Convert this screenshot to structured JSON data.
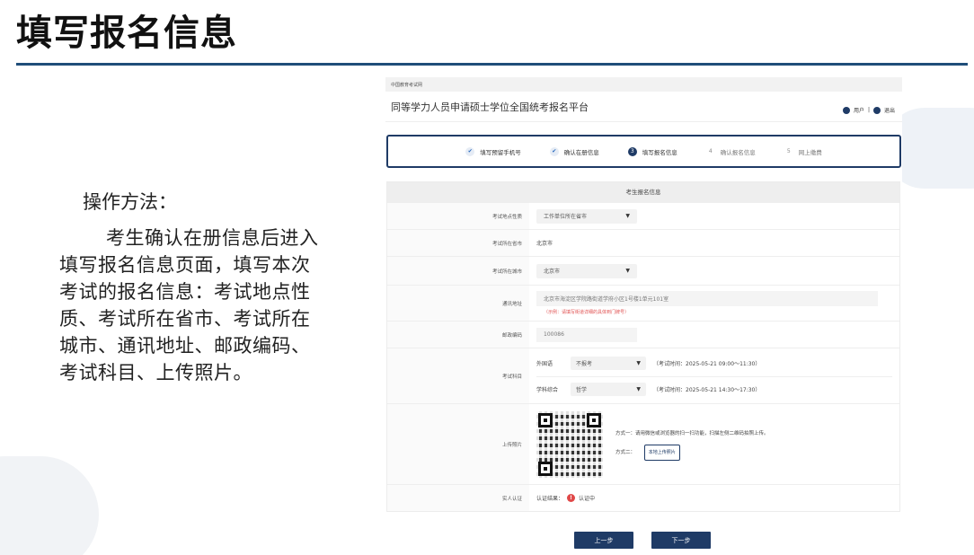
{
  "slide": {
    "title": "填写报名信息",
    "instructions_heading": "操作方法：",
    "instructions_body": "考生确认在册信息后进入填写报名信息页面，填写本次考试的报名信息：考试地点性质、考试所在省市、考试所在城市、通讯地址、邮政编码、考试科目、上传照片。"
  },
  "screenshot": {
    "topbar_text": "中国教育考试网",
    "platform_title": "同等学力人员申请硕士学位全国统考报名平台",
    "user": {
      "name_label": "用户",
      "logout_label": "退出",
      "separator": "|"
    },
    "steps": [
      {
        "num": "✔",
        "label": "填写预留手机号",
        "state": "done"
      },
      {
        "num": "✔",
        "label": "确认在册信息",
        "state": "done"
      },
      {
        "num": "3",
        "label": "填写报名信息",
        "state": "current"
      },
      {
        "num": "4",
        "label": "确认报名信息",
        "state": "todo"
      },
      {
        "num": "5",
        "label": "网上缴费",
        "state": "todo"
      }
    ],
    "form": {
      "header": "考生报名信息",
      "site_type": {
        "label": "考试地点性质",
        "value": "工作单位所在省市"
      },
      "province": {
        "label": "考试所在省市",
        "value": "北京市"
      },
      "city": {
        "label": "考试所在城市",
        "value": "北京市"
      },
      "address": {
        "label": "通讯地址",
        "value": "北京市海淀区学院路街道学府小区1号楼1单元101室",
        "note": "（示例：请填写街道详细的具体到门牌号）"
      },
      "postal": {
        "label": "邮政编码",
        "value": "100086"
      },
      "subjects": {
        "label": "考试科目",
        "items": [
          {
            "name": "外国语",
            "value": "不报考",
            "time": "（考试时间：2025-05-21 09:00～11:30）"
          },
          {
            "name": "学科综合",
            "value": "哲学",
            "time": "（考试时间：2025-05-21 14:30～17:30）"
          }
        ]
      },
      "photo": {
        "label": "上传照片",
        "method1": "方式一：请用微信或浏览器的扫一扫功能，扫描左侧二维码拍照上传。",
        "method2_prefix": "方式二：",
        "method2_button": "本地上传照片"
      },
      "identity": {
        "label": "实人认证",
        "result_label": "认证结果：",
        "status": "认证中"
      }
    },
    "buttons": {
      "prev": "上一步",
      "next": "下一步"
    }
  }
}
